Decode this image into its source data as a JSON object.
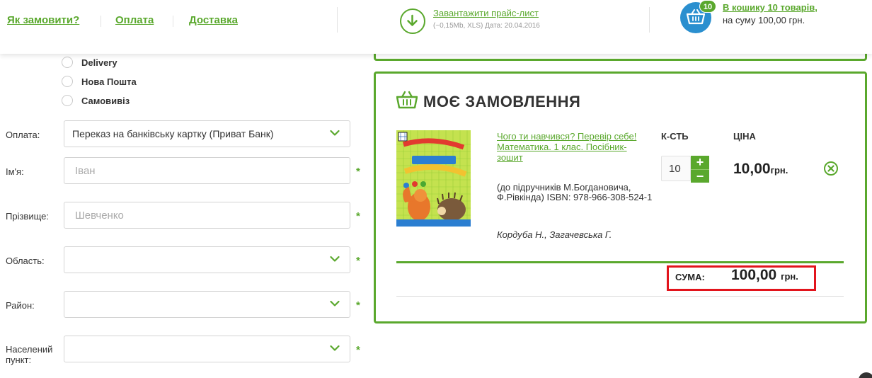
{
  "header": {
    "nav": [
      "Як замовити?",
      "Оплата",
      "Доставка"
    ],
    "download": {
      "link": "Завантажити прайс-лист",
      "meta": "(~0,15Mb, XLS) Дата: 20.04.2016"
    },
    "cart": {
      "badge": "10",
      "link": "В кошику 10 товарів,",
      "sum": "на суму 100,00 грн."
    }
  },
  "delivery_options": [
    "Delivery",
    "Нова Пошта",
    "Самовивіз"
  ],
  "form": {
    "payment": {
      "label": "Оплата:",
      "value": "Переказ на банківську картку (Приват Банк)"
    },
    "name": {
      "label": "Ім'я:",
      "placeholder": "Іван"
    },
    "surname": {
      "label": "Прізвище:",
      "placeholder": "Шевченко"
    },
    "region": {
      "label": "Область:",
      "value": ""
    },
    "district": {
      "label": "Район:",
      "value": ""
    },
    "city": {
      "label": "Населений пункт:",
      "value": ""
    },
    "required_mark": "*"
  },
  "order": {
    "title": "МОЄ ЗАМОВЛЕННЯ",
    "qty_header": "К-СТЬ",
    "price_header": "ЦІНА",
    "item": {
      "name": "Чого ти навчився? Перевір себе! Математика. 1 клас. Посібник-зошит",
      "description": "(до підручників М.Богдановича, Ф.Рівкінда) ISBN: 978-966-308-524-1",
      "author": "Кордуба Н., Загачевська Г.",
      "qty": "10",
      "price": "10,00",
      "currency": "грн."
    },
    "plus": "+",
    "minus": "−",
    "sum_label": "СУМА:",
    "sum_value": "100,00",
    "sum_currency": "грн."
  },
  "colors": {
    "accent": "#5aa82d",
    "cart_blue": "#2a8fcf",
    "highlight_red": "#e2141c"
  },
  "icons": [
    "download-arrow-icon",
    "basket-icon",
    "chevron-down-icon",
    "remove-circle-icon"
  ]
}
